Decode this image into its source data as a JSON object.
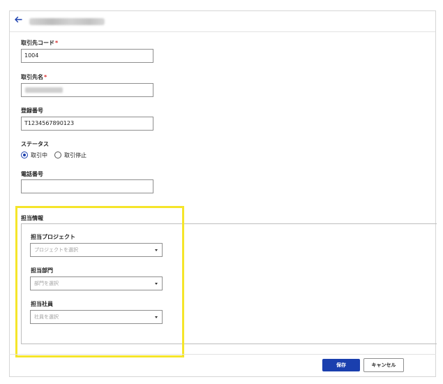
{
  "header": {
    "back_icon": "arrow-left-icon"
  },
  "form": {
    "code": {
      "label": "取引先コード",
      "required_mark": "*",
      "value": "1004"
    },
    "name": {
      "label": "取引先名",
      "required_mark": "*"
    },
    "registration": {
      "label": "登録番号",
      "value": "T1234567890123"
    },
    "status": {
      "label": "ステータス",
      "options": [
        {
          "label": "取引中",
          "checked": true
        },
        {
          "label": "取引停止",
          "checked": false
        }
      ]
    },
    "phone": {
      "label": "電話番号",
      "value": ""
    }
  },
  "assignment": {
    "section_title": "担当情報",
    "project": {
      "label": "担当プロジェクト",
      "placeholder": "プロジェクトを選択"
    },
    "department": {
      "label": "担当部門",
      "placeholder": "部門を選択"
    },
    "employee": {
      "label": "担当社員",
      "placeholder": "社員を選択"
    }
  },
  "footer": {
    "save_label": "保存",
    "cancel_label": "キャンセル"
  },
  "colors": {
    "accent": "#1a3fae",
    "highlight": "#f5e52a",
    "required": "#d92b2b"
  }
}
